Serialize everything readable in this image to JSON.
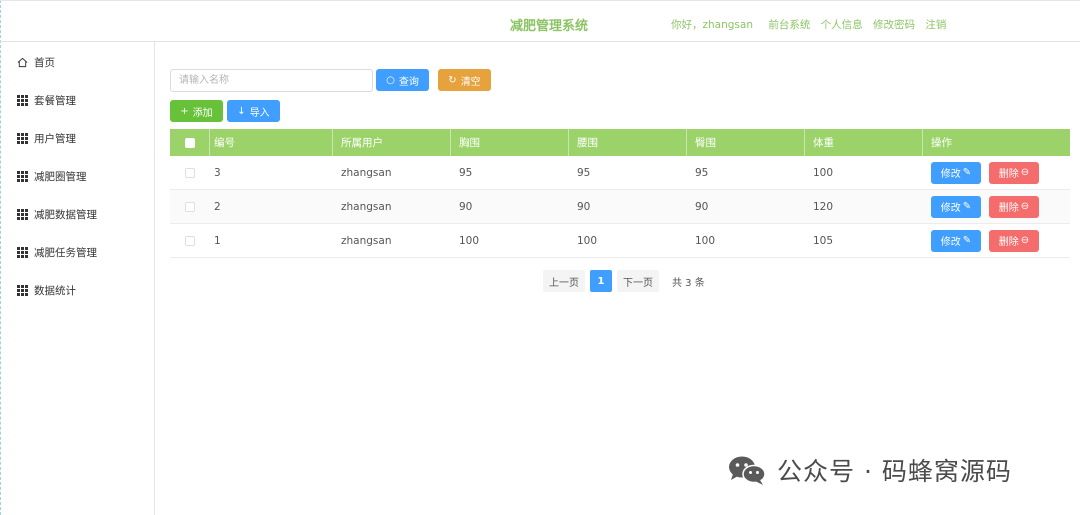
{
  "header": {
    "title": "减肥管理系统",
    "greeting": "你好，zhangsan",
    "links": [
      "前台系统",
      "个人信息",
      "修改密码",
      "注销"
    ]
  },
  "sidebar": {
    "items": [
      {
        "label": "首页",
        "icon": "home-icon"
      },
      {
        "label": "套餐管理",
        "icon": "grid-icon"
      },
      {
        "label": "用户管理",
        "icon": "grid-icon"
      },
      {
        "label": "减肥圈管理",
        "icon": "grid-icon"
      },
      {
        "label": "减肥数据管理",
        "icon": "grid-icon"
      },
      {
        "label": "减肥任务管理",
        "icon": "grid-icon"
      },
      {
        "label": "数据统计",
        "icon": "grid-icon"
      }
    ]
  },
  "search": {
    "placeholder": "请输入名称",
    "value": "",
    "query_label": "查询",
    "clear_label": "清空"
  },
  "toolbar": {
    "add_label": "添加",
    "import_label": "导入"
  },
  "table": {
    "columns": [
      "编号",
      "所属用户",
      "胸围",
      "腰围",
      "臀围",
      "体重",
      "操作"
    ],
    "rows": [
      {
        "id": "3",
        "user": "zhangsan",
        "chest": "95",
        "waist": "95",
        "hip": "95",
        "weight": "100"
      },
      {
        "id": "2",
        "user": "zhangsan",
        "chest": "90",
        "waist": "90",
        "hip": "90",
        "weight": "120"
      },
      {
        "id": "1",
        "user": "zhangsan",
        "chest": "100",
        "waist": "100",
        "hip": "100",
        "weight": "105"
      }
    ],
    "edit_label": "修改",
    "delete_label": "删除"
  },
  "pagination": {
    "prev_label": "上一页",
    "current_page": "1",
    "next_label": "下一页",
    "total_text": "共 3 条"
  },
  "watermark": {
    "text": "公众号 · 码蜂窝源码"
  },
  "colors": {
    "accent_green": "#9bd36a",
    "title_green": "#8dc466",
    "primary_blue": "#409eff",
    "warning_orange": "#e6a23c",
    "success_green": "#67c23a",
    "danger_red": "#f56c6c"
  }
}
